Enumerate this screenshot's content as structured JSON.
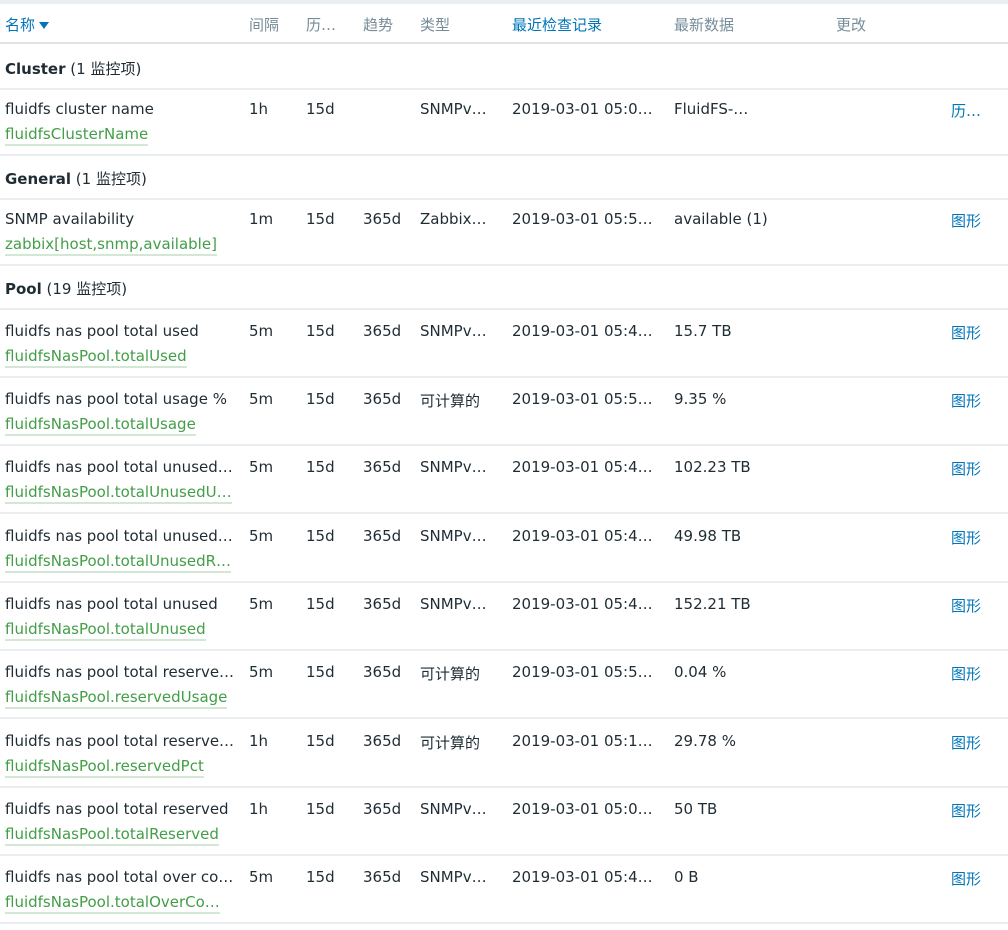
{
  "header": {
    "name": "名称",
    "interval": "间隔",
    "history": "历…",
    "trends": "趋势",
    "type": "类型",
    "lastcheck": "最近检查记录",
    "lastvalue": "最新数据",
    "change": "更改"
  },
  "groups": [
    {
      "name": "Cluster",
      "count": "(1 监控项)"
    },
    {
      "name": "General",
      "count": "(1 监控项)"
    },
    {
      "name": "Pool",
      "count": "(19 监控项)"
    }
  ],
  "items": [
    {
      "name": "fluidfs cluster name",
      "key": "fluidfsClusterName",
      "interval": "1h",
      "history": "15d",
      "trends": "",
      "type": "SNMPv…",
      "lastcheck": "2019-03-01 05:0…",
      "lastvalue": "FluidFS-…",
      "change": "",
      "action": "历…"
    },
    {
      "name": "SNMP availability",
      "key": "zabbix[host,snmp,available]",
      "interval": "1m",
      "history": "15d",
      "trends": "365d",
      "type": "Zabbix…",
      "lastcheck": "2019-03-01 05:5…",
      "lastvalue": "available (1)",
      "change": "",
      "action": "图形"
    },
    {
      "name": "fluidfs nas pool total used",
      "key": "fluidfsNasPool.totalUsed",
      "interval": "5m",
      "history": "15d",
      "trends": "365d",
      "type": "SNMPv…",
      "lastcheck": "2019-03-01 05:4…",
      "lastvalue": "15.7 TB",
      "change": "",
      "action": "图形"
    },
    {
      "name": "fluidfs nas pool total usage %",
      "key": "fluidfsNasPool.totalUsage",
      "interval": "5m",
      "history": "15d",
      "trends": "365d",
      "type": "可计算的",
      "lastcheck": "2019-03-01 05:5…",
      "lastvalue": "9.35 %",
      "change": "",
      "action": "图形"
    },
    {
      "name": "fluidfs nas pool total unused …",
      "key": "fluidfsNasPool.totalUnusedU…",
      "interval": "5m",
      "history": "15d",
      "trends": "365d",
      "type": "SNMPv…",
      "lastcheck": "2019-03-01 05:4…",
      "lastvalue": "102.23 TB",
      "change": "",
      "action": "图形"
    },
    {
      "name": "fluidfs nas pool total unused …",
      "key": "fluidfsNasPool.totalUnusedR…",
      "interval": "5m",
      "history": "15d",
      "trends": "365d",
      "type": "SNMPv…",
      "lastcheck": "2019-03-01 05:4…",
      "lastvalue": "49.98 TB",
      "change": "",
      "action": "图形"
    },
    {
      "name": "fluidfs nas pool total unused",
      "key": "fluidfsNasPool.totalUnused",
      "interval": "5m",
      "history": "15d",
      "trends": "365d",
      "type": "SNMPv…",
      "lastcheck": "2019-03-01 05:4…",
      "lastvalue": "152.21 TB",
      "change": "",
      "action": "图形"
    },
    {
      "name": "fluidfs nas pool total reserve…",
      "key": "fluidfsNasPool.reservedUsage",
      "interval": "5m",
      "history": "15d",
      "trends": "365d",
      "type": "可计算的",
      "lastcheck": "2019-03-01 05:5…",
      "lastvalue": "0.04 %",
      "change": "",
      "action": "图形"
    },
    {
      "name": "fluidfs nas pool total reserve…",
      "key": "fluidfsNasPool.reservedPct",
      "interval": "1h",
      "history": "15d",
      "trends": "365d",
      "type": "可计算的",
      "lastcheck": "2019-03-01 05:1…",
      "lastvalue": "29.78 %",
      "change": "",
      "action": "图形"
    },
    {
      "name": "fluidfs nas pool total reserved",
      "key": "fluidfsNasPool.totalReserved",
      "interval": "1h",
      "history": "15d",
      "trends": "365d",
      "type": "SNMPv…",
      "lastcheck": "2019-03-01 05:0…",
      "lastvalue": "50 TB",
      "change": "",
      "action": "图形"
    },
    {
      "name": "fluidfs nas pool total over co…",
      "key": "fluidfsNasPool.totalOverCo…",
      "interval": "5m",
      "history": "15d",
      "trends": "365d",
      "type": "SNMPv…",
      "lastcheck": "2019-03-01 05:4…",
      "lastvalue": "0 B",
      "change": "",
      "action": "图形"
    }
  ]
}
